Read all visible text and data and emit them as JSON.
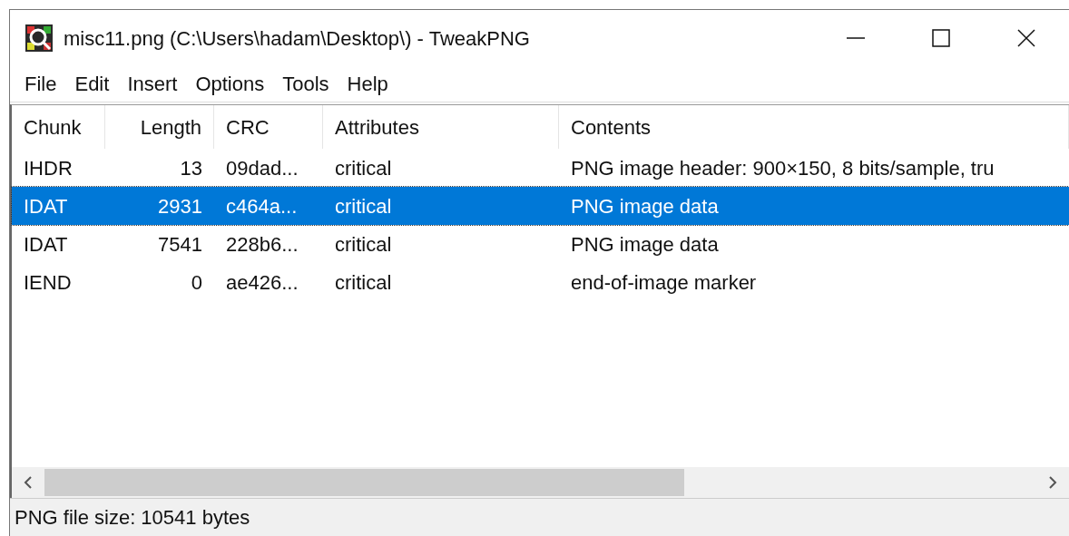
{
  "window": {
    "title": "misc11.png (C:\\Users\\hadam\\Desktop\\) - TweakPNG"
  },
  "menu": [
    "File",
    "Edit",
    "Insert",
    "Options",
    "Tools",
    "Help"
  ],
  "table": {
    "columns": [
      "Chunk",
      "Length",
      "CRC",
      "Attributes",
      "Contents"
    ],
    "rows": [
      {
        "selected": false,
        "cells": [
          "IHDR",
          "13",
          "09dad...",
          "critical",
          "PNG image header: 900×150, 8 bits/sample, tru"
        ]
      },
      {
        "selected": true,
        "cells": [
          "IDAT",
          "2931",
          "c464a...",
          "critical",
          "PNG image data"
        ]
      },
      {
        "selected": false,
        "cells": [
          "IDAT",
          "7541",
          "228b6...",
          "critical",
          "PNG image data"
        ]
      },
      {
        "selected": false,
        "cells": [
          "IEND",
          "0",
          "ae426...",
          "critical",
          "end-of-image marker"
        ]
      }
    ]
  },
  "status_bar": "PNG file size: 10541 bytes"
}
